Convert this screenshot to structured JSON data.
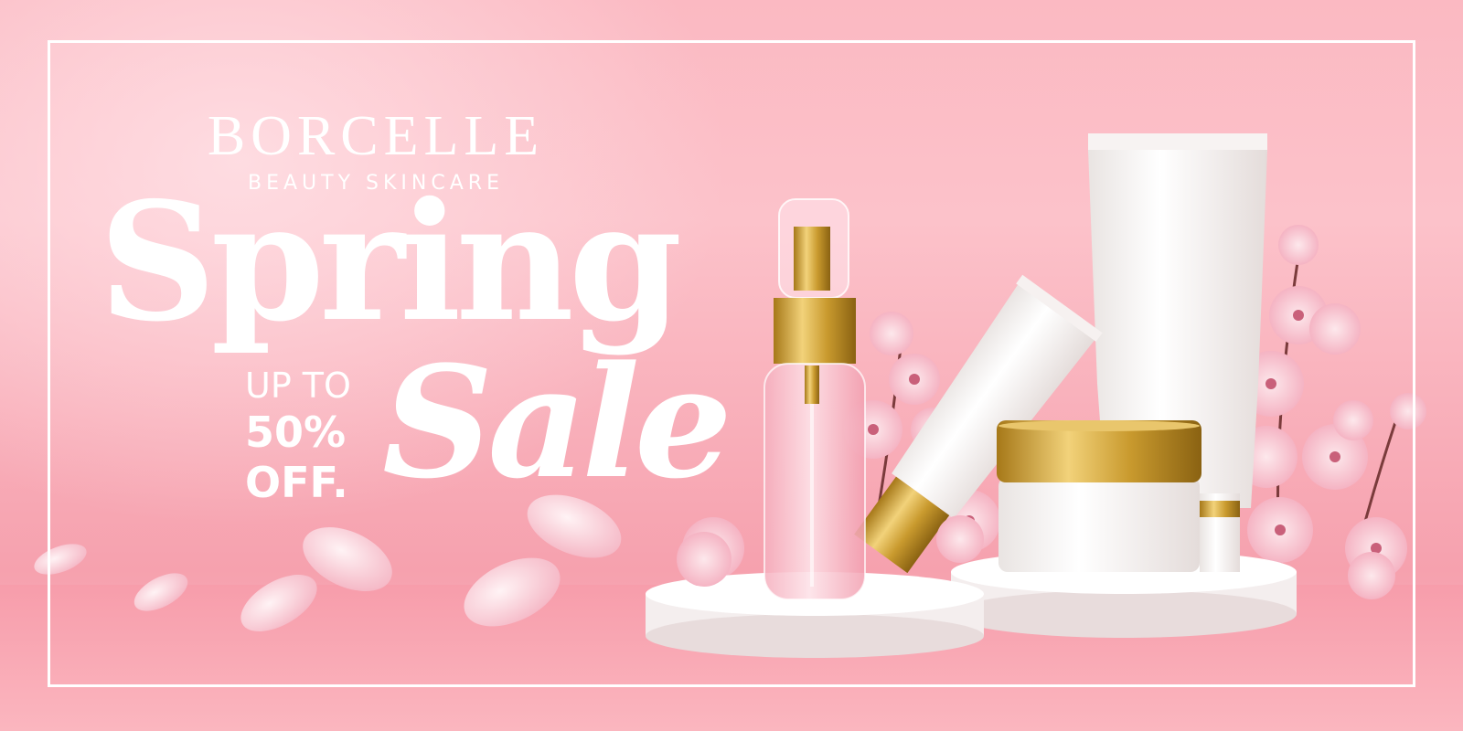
{
  "brand": {
    "name": "BORCELLE",
    "tagline": "BEAUTY SKINCARE"
  },
  "promo": {
    "headline": "Spring",
    "headline_2": "Sale",
    "up_to": "UP TO",
    "percent": "50%",
    "off": "OFF."
  },
  "colors": {
    "background": "#fbb9c2",
    "text": "#ffffff",
    "gold": "#c99a2e",
    "blossom": "#f7c9d3"
  }
}
